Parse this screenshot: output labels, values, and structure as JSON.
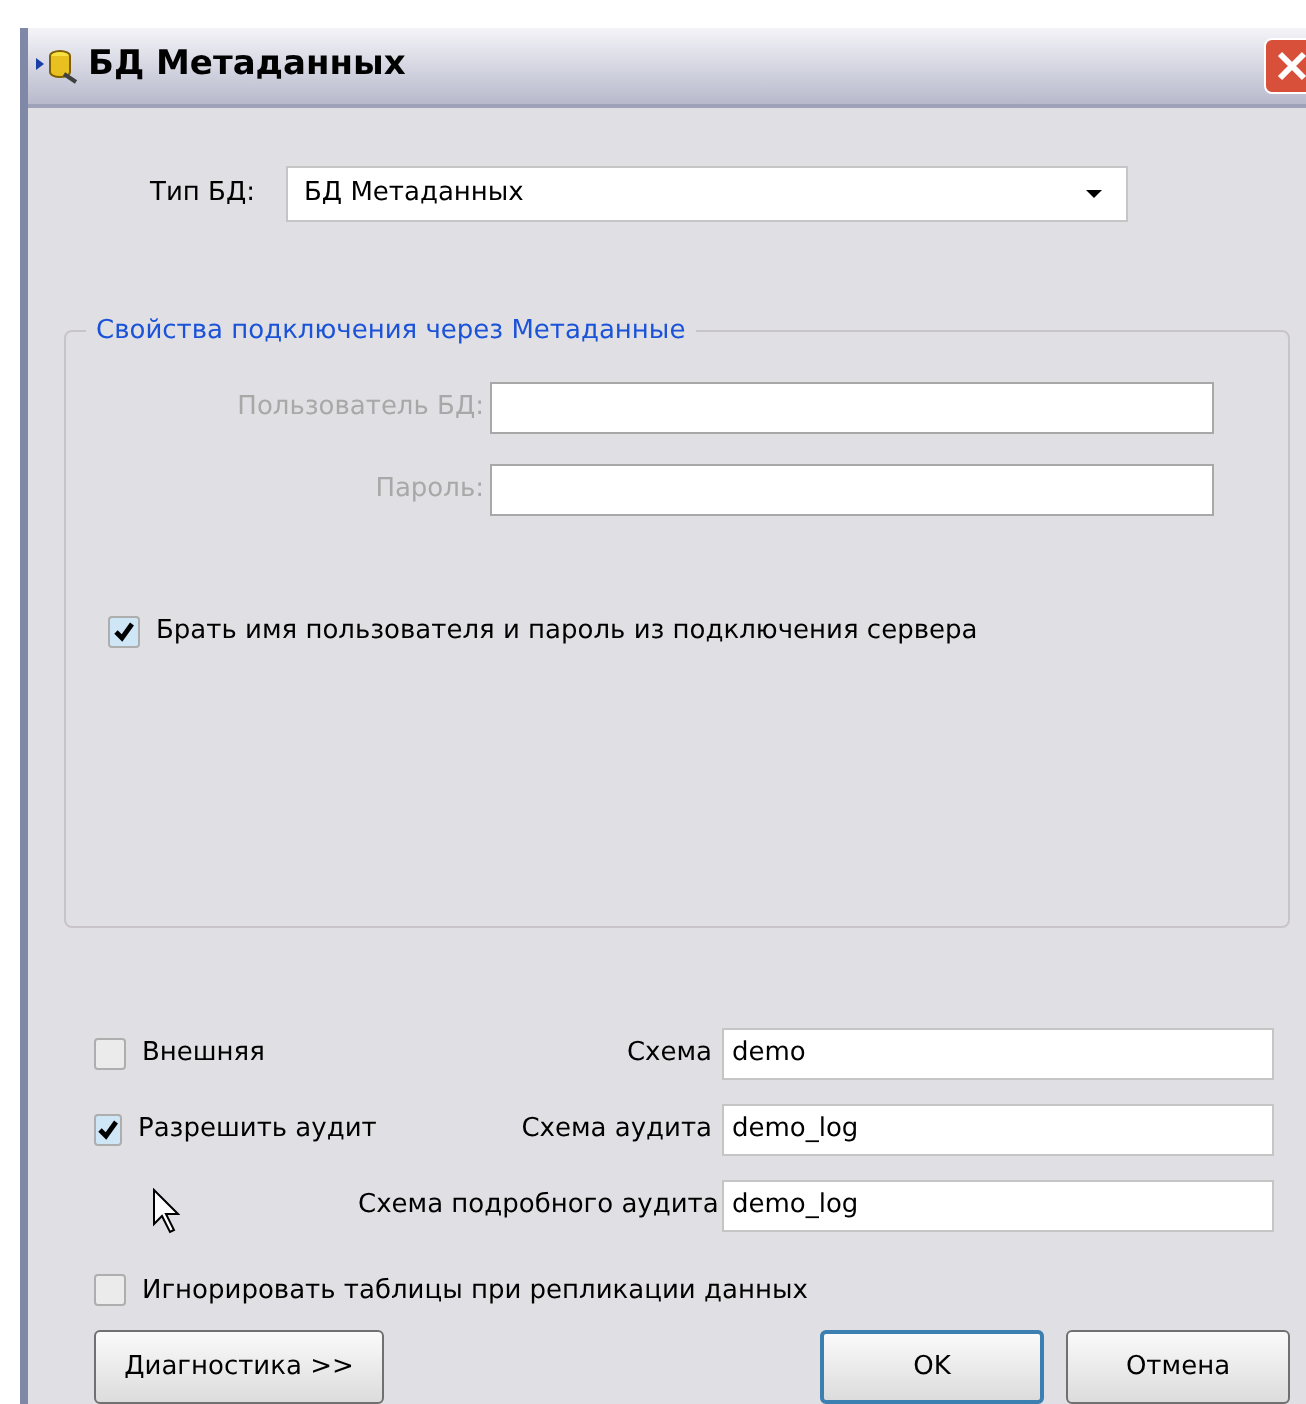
{
  "window": {
    "title": "БД Метаданных"
  },
  "db_type": {
    "label": "Тип БД:",
    "value": "БД Метаданных"
  },
  "connection_group": {
    "legend": "Свойства подключения через Метаданные",
    "fields": [
      {
        "label": "Пользователь БД:",
        "disabled": true
      },
      {
        "label": "Пароль:",
        "disabled": true
      }
    ],
    "use_server_credentials": {
      "label": "Брать имя пользователя и пароль из подключения сервера",
      "checked": true
    }
  },
  "options": [
    {
      "checkbox": {
        "label": "Внешняя",
        "checked": false
      },
      "field_label": "Схема",
      "value": "demo"
    },
    {
      "checkbox": {
        "label": "Разрешить аудит",
        "checked": true
      },
      "field_label": "Схема аудита",
      "value": "demo_log"
    },
    {
      "field_label": "Схема подробного аудита",
      "value": "demo_log"
    }
  ],
  "ignore_tables": {
    "label": "Игнорировать таблицы при репликации данных",
    "checked": false
  },
  "buttons": [
    {
      "label": "Диагностика >>",
      "kind": "secondary"
    },
    {
      "label": "OK",
      "kind": "default"
    },
    {
      "label": "Отмена",
      "kind": "secondary"
    }
  ]
}
